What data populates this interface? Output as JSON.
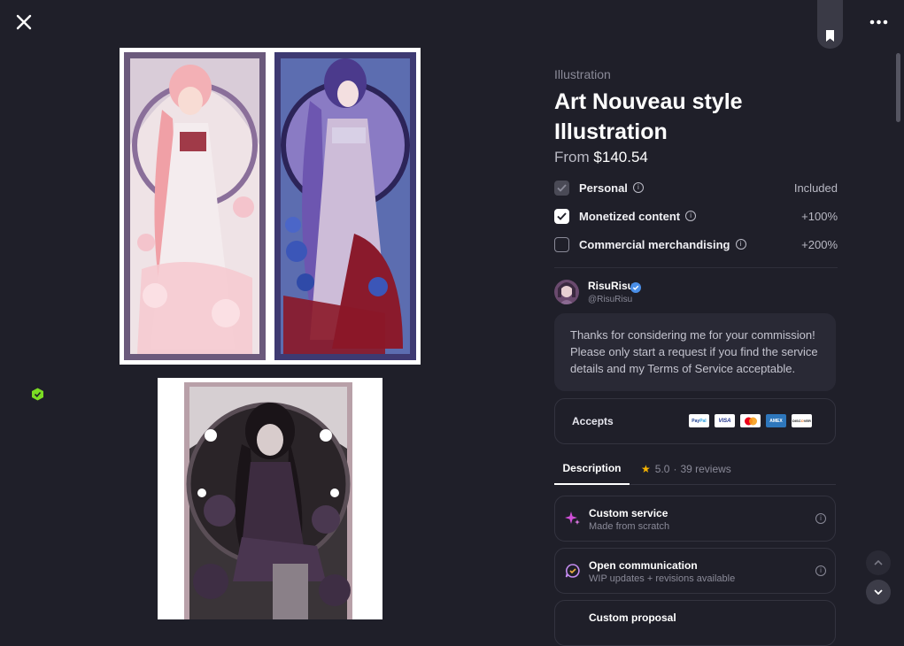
{
  "header": {
    "close_icon": "close-icon",
    "more_icon": "more-horizontal-icon",
    "bookmark_icon": "bookmark-icon"
  },
  "listing": {
    "category": "Illustration",
    "title": "Art Nouveau style Illustration",
    "price_prefix": "From",
    "price": "$140.54",
    "options": [
      {
        "label": "Personal",
        "value": "Included",
        "state": "disabled-checked"
      },
      {
        "label": "Monetized content",
        "value": "+100%",
        "state": "checked"
      },
      {
        "label": "Commercial merchandising",
        "value": "+200%",
        "state": "unchecked"
      }
    ]
  },
  "seller": {
    "name": "RisuRisu",
    "handle": "@RisuRisu",
    "verified": true,
    "message": "Thanks for considering me for your commission! Please only start a request if you find the service details and my Terms of Service acceptable."
  },
  "accepts": {
    "label": "Accepts",
    "cards": [
      "PayPal",
      "VISA",
      "Mastercard",
      "AMEX",
      "DISCOVER"
    ]
  },
  "tabs": {
    "description": "Description",
    "rating": "5.0",
    "reviews": "39 reviews"
  },
  "features": [
    {
      "title": "Custom service",
      "subtitle": "Made from scratch",
      "icon": "sparkle-icon"
    },
    {
      "title": "Open communication",
      "subtitle": "WIP updates + revisions available",
      "icon": "chat-icon"
    },
    {
      "title": "Custom proposal",
      "subtitle": "",
      "icon": "proposal-icon"
    }
  ],
  "colors": {
    "background": "#1f1f29",
    "card": "#292935",
    "accent_star": "#f5b301",
    "badge": "#7bdc23"
  }
}
